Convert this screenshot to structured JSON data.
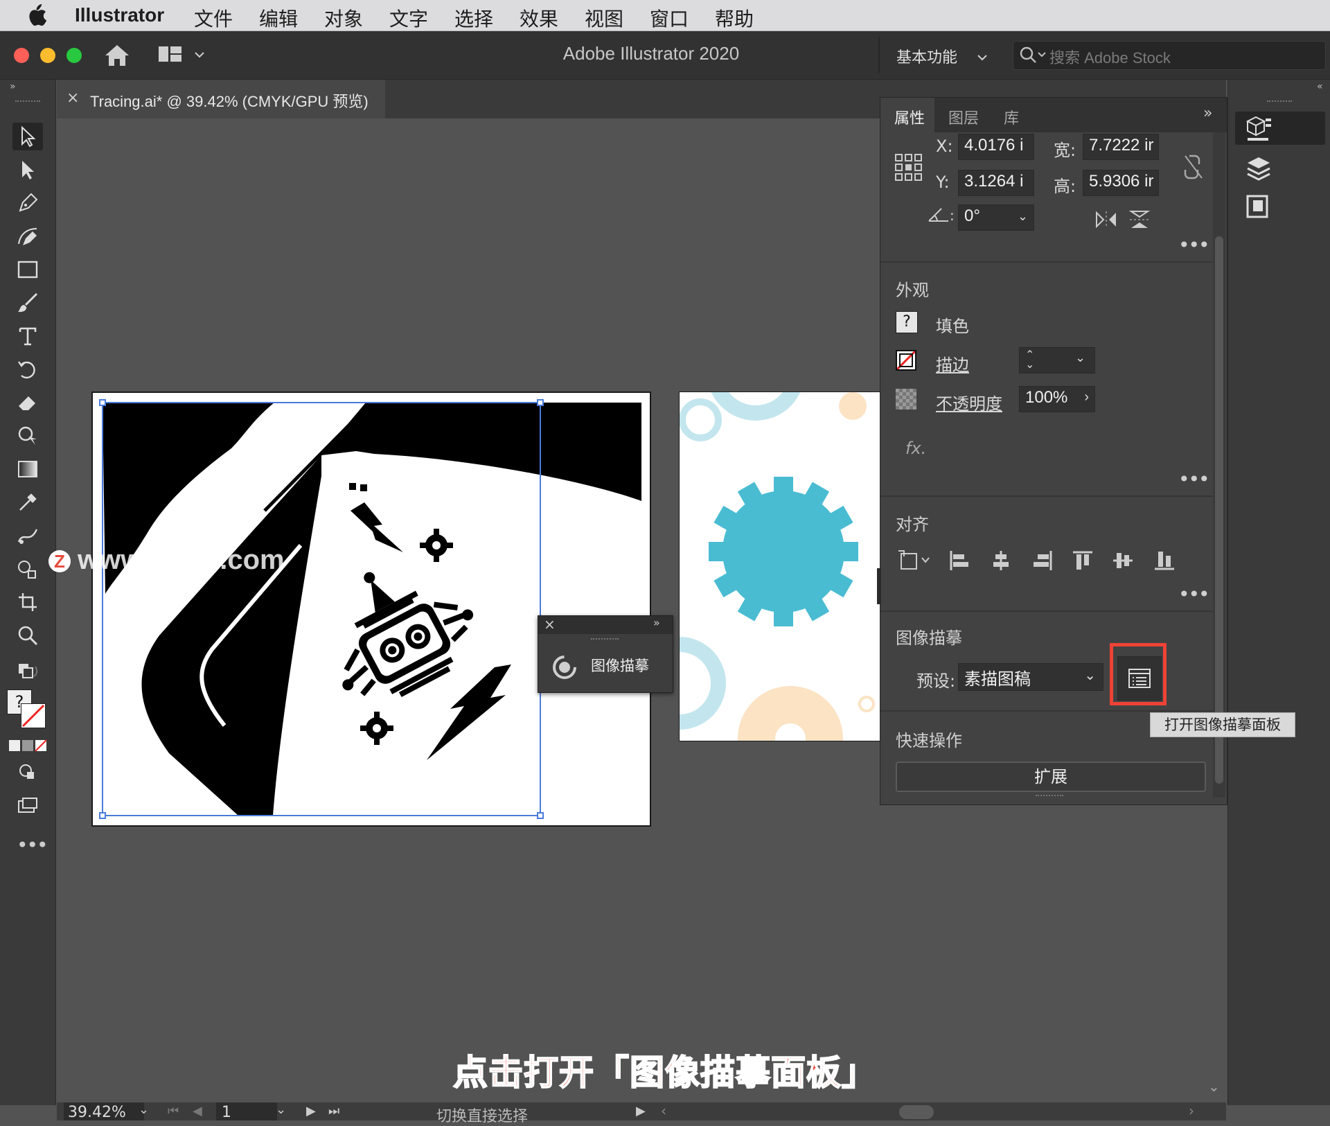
{
  "menubar": {
    "app_name": "Illustrator",
    "items": [
      "文件",
      "编辑",
      "对象",
      "文字",
      "选择",
      "效果",
      "视图",
      "窗口",
      "帮助"
    ]
  },
  "appbar": {
    "title": "Adobe Illustrator 2020",
    "workspace": "基本功能",
    "search_placeholder": "搜索 Adobe Stock"
  },
  "document_tab": {
    "close": "×",
    "title": "Tracing.ai* @ 39.42% (CMYK/GPU 预览)"
  },
  "mini_panel": {
    "label": "图像描摹"
  },
  "properties": {
    "tabs": [
      "属性",
      "图层",
      "库"
    ],
    "transform": {
      "x_label": "X:",
      "x_value": "4.0176 i",
      "y_label": "Y:",
      "y_value": "3.1264 i",
      "w_label": "宽:",
      "w_value": "7.7222 ir",
      "h_label": "高:",
      "h_value": "5.9306 ir",
      "angle_value": "0°"
    },
    "appearance": {
      "title": "外观",
      "fill_label": "填色",
      "stroke_label": "描边",
      "opacity_label": "不透明度",
      "opacity_value": "100%",
      "fx_label": "fx."
    },
    "align": {
      "title": "对齐"
    },
    "image_trace": {
      "title": "图像描摹",
      "preset_label": "预设:",
      "preset_value": "素描图稿"
    },
    "quick_actions": {
      "title": "快速操作",
      "expand_label": "扩展"
    }
  },
  "tooltip": "打开图像描摹面板",
  "caption": "点击打开「图像描摹面板」",
  "watermark": "www.MacZ.com",
  "statusbar": {
    "zoom": "39.42%",
    "page": "1",
    "status_text": "切换直接选择"
  },
  "colors": {
    "accent_highlight": "#ee4236",
    "gear_blue": "#49bcd2",
    "gear_light_blue": "#c3e6ee",
    "gear_peach": "#fbe3c4",
    "selection_blue": "#4a7bdc"
  }
}
